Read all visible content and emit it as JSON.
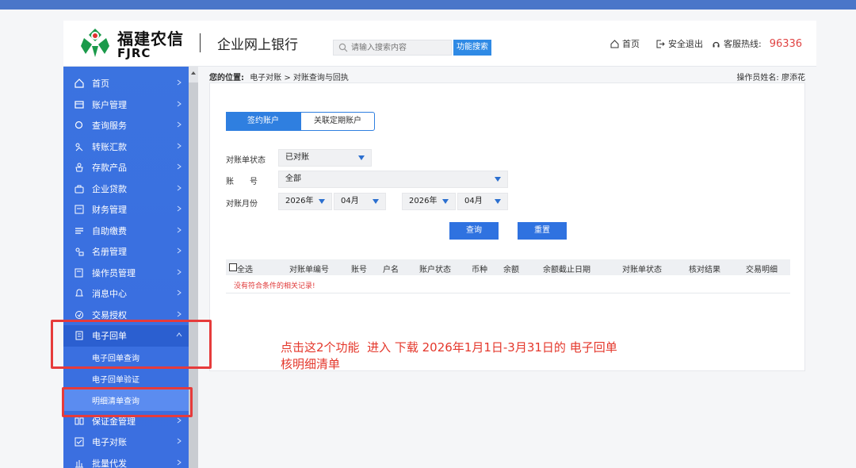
{
  "header": {
    "brand_cn": "福建农信",
    "brand_en": "FJRC",
    "system_title": "企业网上银行",
    "search_placeholder": "请输入搜索内容",
    "search_button": "功能搜索",
    "home_label": "首页",
    "logout_label": "安全退出",
    "hotline_label": "客服热线:",
    "hotline_number": "96336"
  },
  "sidebar": {
    "items": [
      {
        "label": "首页",
        "icon": "home-icon"
      },
      {
        "label": "账户管理",
        "icon": "account-icon"
      },
      {
        "label": "查询服务",
        "icon": "search-icon"
      },
      {
        "label": "转账汇款",
        "icon": "transfer-icon"
      },
      {
        "label": "存款产品",
        "icon": "deposit-icon"
      },
      {
        "label": "企业贷款",
        "icon": "loan-icon"
      },
      {
        "label": "财务管理",
        "icon": "finance-icon"
      },
      {
        "label": "自助缴费",
        "icon": "payment-icon"
      },
      {
        "label": "名册管理",
        "icon": "roster-icon"
      },
      {
        "label": "操作员管理",
        "icon": "operator-icon"
      },
      {
        "label": "消息中心",
        "icon": "bell-icon"
      },
      {
        "label": "交易授权",
        "icon": "authorize-icon"
      },
      {
        "label": "电子回单",
        "icon": "receipt-icon"
      }
    ],
    "sub_items": [
      "电子回单查询",
      "电子回单验证",
      "明细清单查询"
    ],
    "bottom_items": [
      {
        "label": "保证金管理",
        "icon": "deposit-margin-icon"
      },
      {
        "label": "电子对账",
        "icon": "reconcile-icon"
      },
      {
        "label": "批量代发",
        "icon": "batch-icon"
      }
    ]
  },
  "breadcrumb": {
    "prefix": "您的位置:",
    "path": "电子对账 > 对账查询与回执",
    "operator": "操作员姓名: 廖添花"
  },
  "tabs": [
    "签约账户",
    "关联定期账户"
  ],
  "form": {
    "status_label": "对账单状态",
    "status_value": "已对账",
    "account_label": "账　　号",
    "account_value": "全部",
    "month_label": "对账月份",
    "start_year": "2026年",
    "start_month": "04月",
    "end_year": "2026年",
    "end_month": "04月",
    "query_button": "查询",
    "reset_button": "重置"
  },
  "table": {
    "columns": [
      "全选",
      "对账单编号",
      "账号",
      "户名",
      "账户状态",
      "币种",
      "余额",
      "余额截止日期",
      "对账单状态",
      "核对结果",
      "交易明细"
    ],
    "empty_message": "没有符合条件的相关记录!"
  },
  "annotation": {
    "line1": "点击这2个功能  进入 下载 2026年1月1日-3月31日的 电子回单",
    "line2": "核明细清单"
  },
  "colors": {
    "sidebar": "#3b73e0",
    "accent": "#2f7fe0",
    "annotation": "#e4372b"
  }
}
